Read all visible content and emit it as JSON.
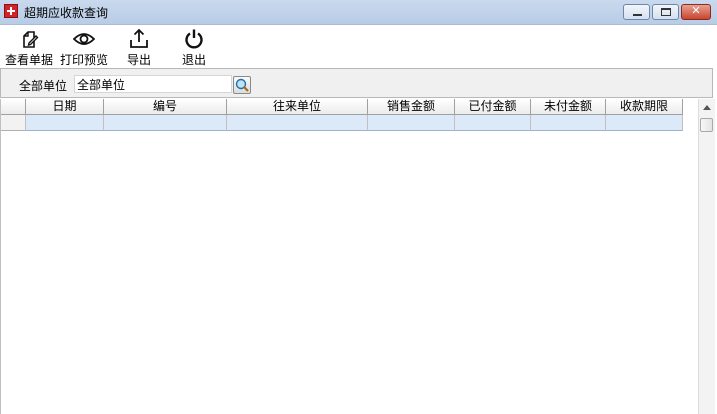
{
  "window": {
    "title": "超期应收款查询"
  },
  "toolbar": {
    "items": [
      {
        "label": "查看单据",
        "icon": "edit-document-icon"
      },
      {
        "label": "打印预览",
        "icon": "eye-icon"
      },
      {
        "label": "导出",
        "icon": "upload-icon"
      },
      {
        "label": "退出",
        "icon": "power-icon"
      }
    ]
  },
  "filter": {
    "label": "全部单位",
    "value": "全部单位"
  },
  "table": {
    "columns": [
      "日期",
      "编号",
      "往来单位",
      "销售金额",
      "已付金额",
      "未付金额",
      "收款期限"
    ],
    "rows": [
      {
        "日期": "",
        "编号": "",
        "往来单位": "",
        "销售金额": "",
        "已付金额": "",
        "未付金额": "",
        "收款期限": ""
      }
    ]
  },
  "colors": {
    "titlebar": "#c9d9ee",
    "selected_row": "#dce9f8",
    "close_button": "#c8452f"
  }
}
